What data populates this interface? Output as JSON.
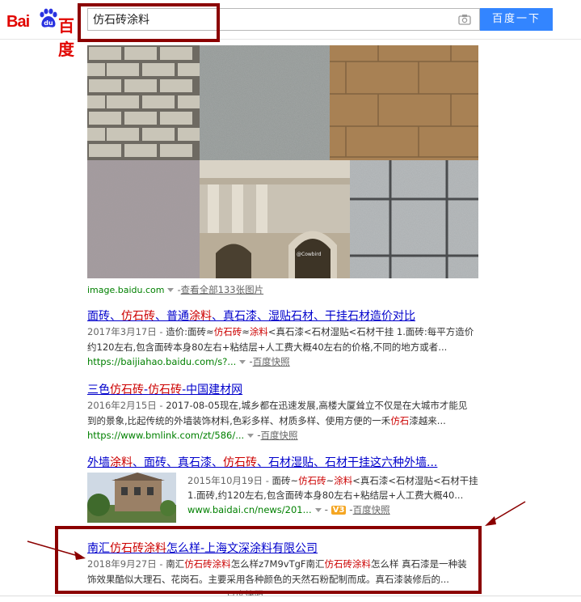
{
  "header": {
    "logo_text_a": "Bai",
    "logo_text_b": "du",
    "logo_text_c": "百度",
    "search_value": "仿石砖涂料",
    "search_button": "百度一下"
  },
  "images": {
    "source": "image.baidu.com",
    "view_all": "查看全部133张图片",
    "watermark": "@Cowbird"
  },
  "results": [
    {
      "title_parts": [
        "面砖、",
        "仿石砖",
        "、普通",
        "涂料",
        "、真石漆、湿贴石材、干挂石材造价对比"
      ],
      "line1_parts": [
        "2017年3月17日 - ",
        "造价:面砖≈",
        "仿石砖",
        "≈",
        "涂料",
        "<真石漆<石材湿贴<石材干挂 1.面砖:每平方造价"
      ],
      "line2": "约120左右,包含面砖本身80左右+粘结层+人工费大概40左右的价格,不同的地方或者...",
      "url": "https://baijiahao.baidu.com/s?...",
      "kuaizhao": "百度快照"
    },
    {
      "title_parts": [
        "三色",
        "仿石砖",
        "-",
        "仿石砖",
        "-中国建材网"
      ],
      "line1_parts": [
        "2016年2月15日 - ",
        "2017-08-05现在,城乡都在迅速发展,高楼大厦耸立不仅是在大城市才能见"
      ],
      "line2_parts": [
        "到的景象,比起传统的外墙装饰材料,色彩多样、材质多样、使用方便的一禾",
        "仿石",
        "漆越来..."
      ],
      "url": "https://www.bmlink.com/zt/586/...",
      "kuaizhao": "百度快照"
    },
    {
      "title_parts": [
        "外墙",
        "涂料",
        "、面砖、真石漆、",
        "仿石砖",
        "、石材湿贴、石材干挂这六种外墙..."
      ],
      "line1_parts": [
        "2015年10月19日 - ",
        "面砖~",
        "仿石砖",
        "~",
        "涂料",
        "<真石漆<石材湿贴<石材干挂"
      ],
      "line2": "1.面砖,约120左右,包含面砖本身80左右+粘结层+人工费大概40...",
      "url": "www.baidai.cn/news/201...",
      "v_badge": "V3",
      "kuaizhao": "百度快照"
    },
    {
      "title_parts": [
        "南汇",
        "仿石砖涂料",
        "怎么样-上海文深涂料有限公司"
      ],
      "line1_parts": [
        "2018年9月27日 - ",
        "南汇",
        "仿石砖涂料",
        "怎么样z7M9vTgF南汇",
        "仿石砖涂料",
        "怎么样 真石漆是一种装"
      ],
      "line2": "饰效果酷似大理石、花岗石。主要采用各种颜色的天然石粉配制而成。真石漆装修后的...",
      "kuaizhao": "百度快照"
    }
  ],
  "colors": {
    "brand_red": "#e10601",
    "button_blue": "#3385ff",
    "link_blue": "#0000cc",
    "highlight_red": "#cc0000",
    "url_green": "#008000",
    "annotation": "#8b0000"
  }
}
